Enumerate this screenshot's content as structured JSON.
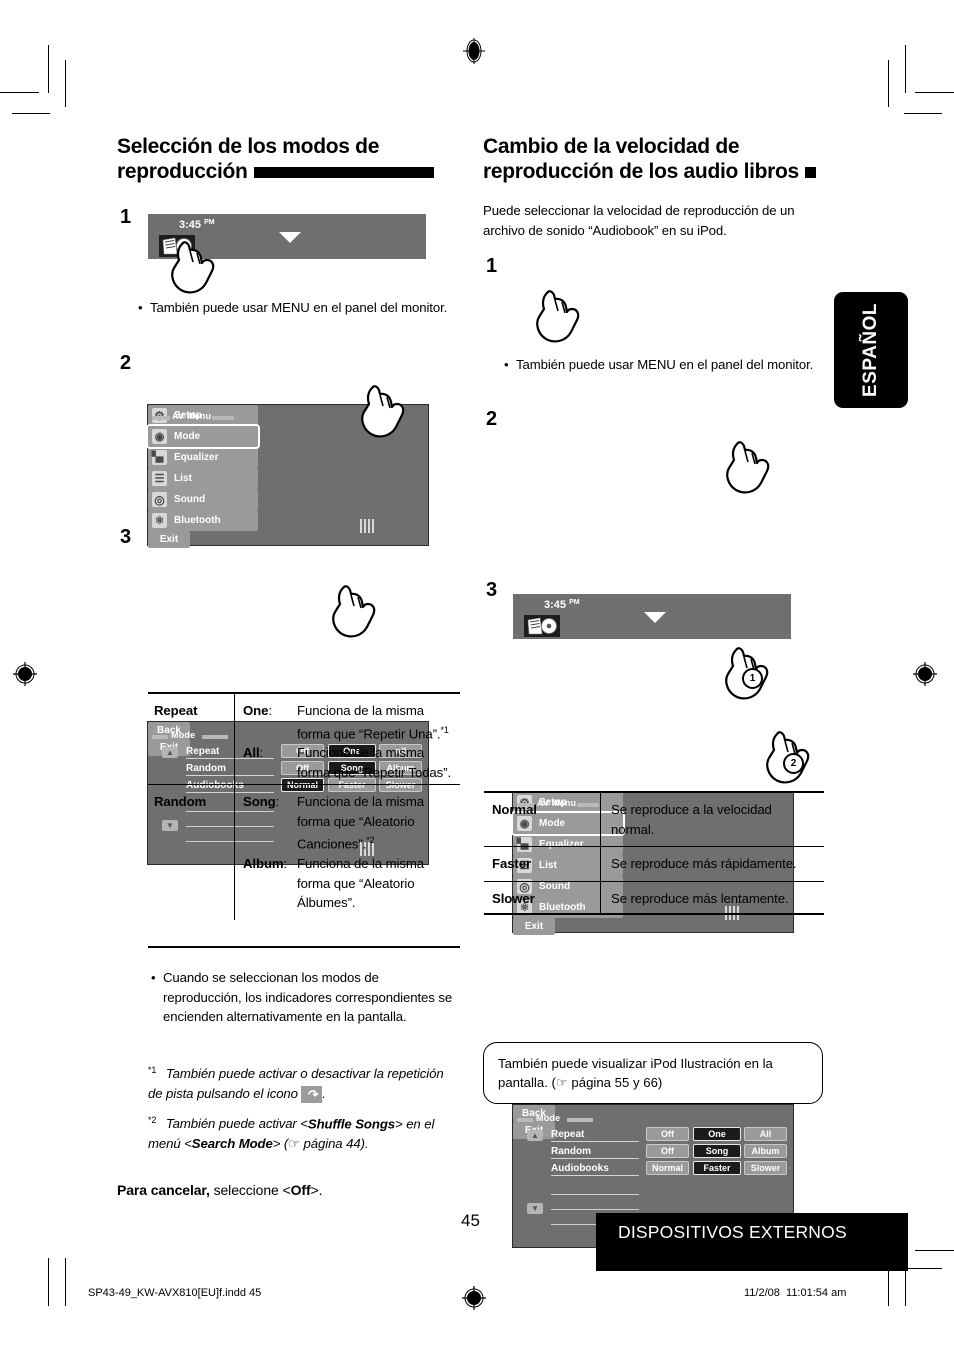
{
  "page": {
    "number": "45",
    "footer_section": "DISPOSITIVOS EXTERNOS",
    "side_tab": "ESPAÑOL",
    "print_file": "SP43-49_KW-AVX810[EU]f.indd   45",
    "print_date": "11/2/08",
    "print_time": "11:01:54 am"
  },
  "left": {
    "heading": "Selección de los modos de reproducción",
    "step1": {
      "num": "1",
      "screen": {
        "time": "3:45",
        "ampm": "PM",
        "source_icon": "ipod-source-icon",
        "dropdown_icon": "triangle-down-icon"
      },
      "bullet": "También puede usar MENU en el panel del monitor."
    },
    "step2": {
      "num": "2",
      "screen_title": "AV Menu",
      "buttons": [
        {
          "label": "Setup",
          "icon": "gear-icon"
        },
        {
          "label": "Mode",
          "icon": "mode-icon"
        },
        {
          "label": "Equalizer",
          "icon": "equalizer-icon"
        },
        {
          "label": "List",
          "icon": "list-icon"
        },
        {
          "label": "Sound",
          "icon": "sound-icon"
        },
        {
          "label": "Bluetooth",
          "icon": "bluetooth-icon"
        }
      ],
      "exit": "Exit"
    },
    "step3": {
      "num": "3",
      "screen_title": "Mode",
      "rows": [
        {
          "label": "Repeat",
          "options": [
            "Off",
            "One",
            "All"
          ],
          "selected": "One"
        },
        {
          "label": "Random",
          "options": [
            "Off",
            "Song",
            "Album"
          ],
          "selected": "Song"
        },
        {
          "label": "Audiobooks",
          "options": [
            "Normal",
            "Faster",
            "Slower"
          ],
          "selected": "Normal"
        }
      ],
      "back": "Back",
      "exit": "Exit"
    },
    "table": [
      {
        "name": "Repeat",
        "entries": [
          {
            "key": "One",
            "desc": "Funciona de la misma forma que “Repetir Una”.",
            "note": "*1"
          },
          {
            "key": "All",
            "desc": "Funciona de la misma forma que “Repetir Todas”.",
            "note": ""
          }
        ]
      },
      {
        "name": "Random",
        "entries": [
          {
            "key": "Song",
            "desc": "Funciona de la misma forma que “Aleatorio Canciones”.",
            "note": "*2"
          },
          {
            "key": "Album",
            "desc": "Funciona de la misma forma que “Aleatorio Álbumes”.",
            "note": ""
          }
        ]
      }
    ],
    "bullet_after": "Cuando se seleccionan los modos de reproducción, los indicadores correspondientes se encienden alternativamente en la pantalla.",
    "footnote1_mark": "*1",
    "footnote1_a": "También puede activar o desactivar la repetición de pista pulsando el icono",
    "footnote1_icon": "repeat-icon",
    "footnote1_b": ".",
    "footnote2_mark": "*2",
    "footnote2_a": "También puede activar <",
    "footnote2_b": "Shuffle Songs",
    "footnote2_c": "> en el menú <",
    "footnote2_d": "Search Mode",
    "footnote2_e": "> (",
    "footnote2_f": "página 44).",
    "cancel_bold": "Para cancelar,",
    "cancel_rest": "seleccione <",
    "cancel_off": "Off",
    "cancel_end": ">."
  },
  "right": {
    "heading": "Cambio de la velocidad de reproducción de los audio libros",
    "intro": "Puede seleccionar la velocidad de reproducción de un archivo de sonido “Audiobook” en su iPod.",
    "step1": {
      "num": "1",
      "screen": {
        "time": "3:45",
        "ampm": "PM",
        "source_icon": "ipod-source-icon",
        "dropdown_icon": "triangle-down-icon"
      },
      "bullet": "También puede usar MENU en el panel del monitor."
    },
    "step2": {
      "num": "2",
      "screen_title": "AV Menu",
      "buttons": [
        {
          "label": "Setup",
          "icon": "gear-icon"
        },
        {
          "label": "Mode",
          "icon": "mode-icon"
        },
        {
          "label": "Equalizer",
          "icon": "equalizer-icon"
        },
        {
          "label": "List",
          "icon": "list-icon"
        },
        {
          "label": "Sound",
          "icon": "sound-icon"
        },
        {
          "label": "Bluetooth",
          "icon": "bluetooth-icon"
        }
      ],
      "exit": "Exit"
    },
    "step3": {
      "num": "3",
      "screen_title": "Mode",
      "rows": [
        {
          "label": "Repeat",
          "options": [
            "Off",
            "One",
            "All"
          ],
          "selected": "One"
        },
        {
          "label": "Random",
          "options": [
            "Off",
            "Song",
            "Album"
          ],
          "selected": "Song"
        },
        {
          "label": "Audiobooks",
          "options": [
            "Normal",
            "Faster",
            "Slower"
          ],
          "selected": "Faster"
        }
      ],
      "back": "Back",
      "exit": "Exit",
      "callout1": "1",
      "callout2": "2"
    },
    "table": [
      {
        "name": "Normal",
        "desc": "Se reproduce a la velocidad normal."
      },
      {
        "name": "Faster",
        "desc": "Se reproduce más rápidamente."
      },
      {
        "name": "Slower",
        "desc": "Se reproduce más lentamente."
      }
    ],
    "note": "También puede visualizar iPod Ilustración en la pantalla. (☞ página 55 y 66)"
  }
}
